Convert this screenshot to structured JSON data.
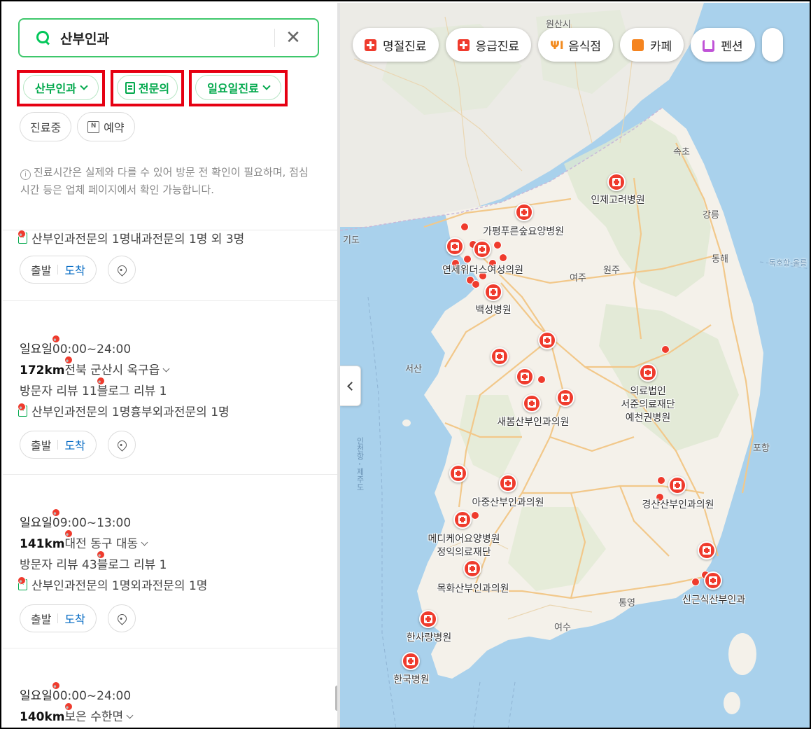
{
  "search": {
    "query": "산부인과",
    "clear_label": "✕"
  },
  "filters_primary": [
    {
      "label": "산부인과",
      "has_dropdown": true
    },
    {
      "label": "전문의",
      "has_dropdown": false
    },
    {
      "label": "일요일진료",
      "has_dropdown": true
    }
  ],
  "filters_secondary": [
    {
      "label": "진료중"
    },
    {
      "label": "예약",
      "icon_text": "N"
    }
  ],
  "notice": {
    "icon": "ⓘ",
    "text": "진료시간은 실제와 다를 수 있어 방문 전 확인이 필요하며, 점심시간 등은 업체 페이지에서 확인 가능합니다."
  },
  "results": [
    {
      "partial": true,
      "specialists": [
        "산부인과전문의 1명",
        "내과전문의 1명 외 3명"
      ],
      "depart_label": "출발",
      "arrive_label": "도착"
    },
    {
      "day": "일요일",
      "hours": "00:00~24:00",
      "distance": "172km",
      "address": "전북 군산시 옥구읍",
      "visitor_reviews": "방문자 리뷰 11",
      "blog_reviews": "블로그 리뷰 1",
      "specialists": [
        "산부인과전문의 1명",
        "흉부외과전문의 1명"
      ],
      "depart_label": "출발",
      "arrive_label": "도착"
    },
    {
      "day": "일요일",
      "hours": "09:00~13:00",
      "distance": "141km",
      "address": "대전 동구 대동",
      "visitor_reviews": "방문자 리뷰 43",
      "blog_reviews": "블로그 리뷰 1",
      "specialists": [
        "산부인과전문의 1명",
        "외과전문의 1명"
      ],
      "depart_label": "출발",
      "arrive_label": "도착"
    },
    {
      "day": "일요일",
      "hours": "00:00~24:00",
      "distance": "140km",
      "address": "보은 수한면"
    }
  ],
  "map": {
    "categories": [
      {
        "label": "명절진료",
        "icon": "cross-icon"
      },
      {
        "label": "응급진료",
        "icon": "cross-icon"
      },
      {
        "label": "음식점",
        "icon": "fork-icon"
      },
      {
        "label": "카페",
        "icon": "cup-icon"
      },
      {
        "label": "펜션",
        "icon": "bed-icon"
      }
    ],
    "hospital_labels": [
      "인제고려병원",
      "가평푸른숲요양병원",
      "연세위더스여성의원",
      "백성병원",
      "의료법인\n서준의료재단\n예천권병원",
      "새봄산부인과의원",
      "아중산부인과의원",
      "경산산부인과의원",
      "메디케어요양병원\n정익의료재단",
      "목화산부인과의원",
      "신근식산부인과",
      "한사랑병원",
      "한국병원"
    ],
    "city_labels": [
      "원산시",
      "속초",
      "강릉",
      "동해",
      "여주",
      "원주",
      "서산",
      "포항",
      "통영",
      "여수",
      "기도"
    ],
    "sea_labels": [
      "인천항 - 제주도",
      "독호항-울릉"
    ],
    "colors": {
      "marker": "#ef3b2d",
      "sea": "#a9d1ec",
      "land": "#f4f1ea",
      "accent": "#03c75a",
      "highlight": "#e60012"
    }
  }
}
